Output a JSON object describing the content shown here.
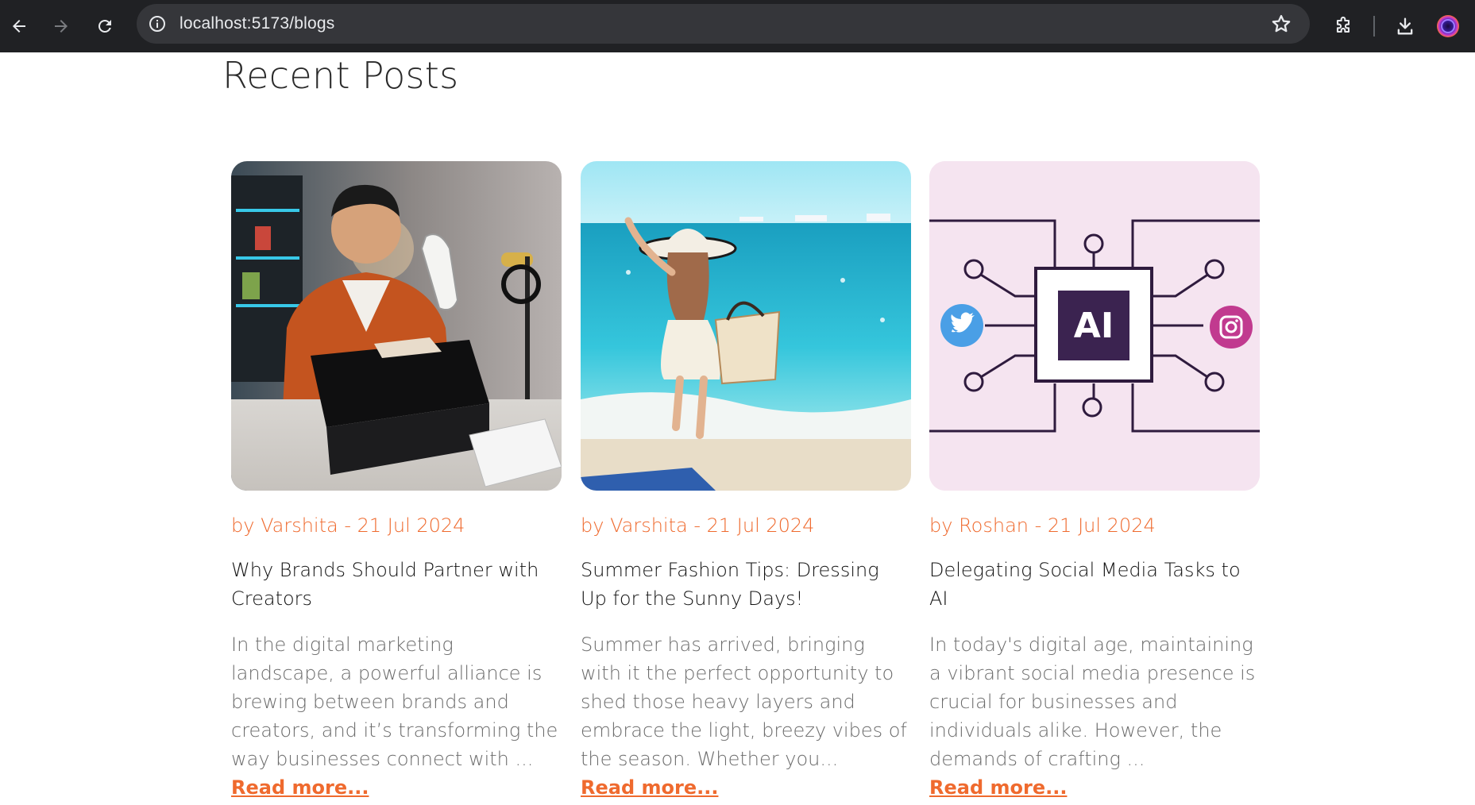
{
  "browser": {
    "url": "localhost:5173/blogs",
    "back_icon": "back-arrow-icon",
    "forward_icon": "forward-arrow-icon",
    "reload_icon": "reload-icon",
    "info_icon": "site-info-icon",
    "bookmark_icon": "star-icon",
    "extensions_icon": "puzzle-icon",
    "download_icon": "download-icon",
    "profile_icon": "profile-avatar-icon"
  },
  "page": {
    "title": "Recent Posts"
  },
  "posts": [
    {
      "meta": "by Varshita - 21 Jul 2024",
      "title": "Why Brands Should Partner with Creators",
      "excerpt": "In the digital marketing landscape, a powerful alliance is brewing between brands and creators, and it’s transforming the way businesses connect with ...",
      "read_more": "Read more..."
    },
    {
      "meta": "by Varshita - 21 Jul 2024",
      "title": "Summer Fashion Tips: Dressing Up for the Sunny Days!",
      "excerpt": "Summer has arrived, bringing with it the perfect opportunity to shed those heavy layers and embrace the light, breezy vibes of the season. Whether you...",
      "read_more": "Read more..."
    },
    {
      "meta": "by Roshan - 21 Jul 2024",
      "title": "Delegating Social Media Tasks to AI",
      "excerpt": "In today's digital age, maintaining a vibrant social media presence is crucial for businesses and individuals alike. However, the demands of crafting ...",
      "read_more": "Read more...",
      "image_chip_label": "AI"
    }
  ],
  "colors": {
    "accent": "#ef6a2e",
    "chrome_bg": "#202124",
    "omnibox_bg": "#35363a"
  }
}
